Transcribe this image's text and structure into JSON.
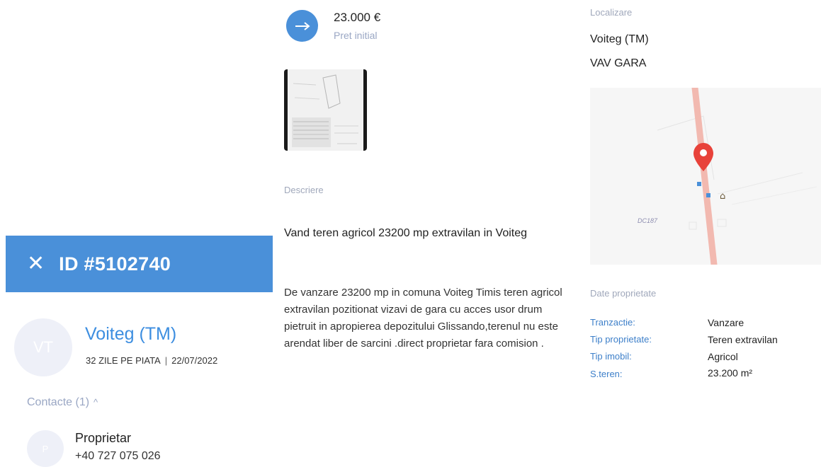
{
  "listing": {
    "id_label": "ID #5102740",
    "close_icon": "close-icon",
    "owner_initials": "VT",
    "city": "Voiteg (TM)",
    "days_on_market": "32 ZILE PE PIATA",
    "meta_separator": "|",
    "date": "22/07/2022",
    "contacts_label": "Contacte (1)",
    "contacts_toggle_icon": "chevron-up-icon",
    "contact": {
      "initial": "P",
      "role": "Proprietar",
      "phone": "+40 727 075 026"
    }
  },
  "price": {
    "icon": "arrow-right-icon",
    "value": "23.000 €",
    "label": "Pret initial"
  },
  "description": {
    "section_label": "Descriere",
    "title": "Vand teren agricol 23200 mp extravilan in Voiteg",
    "body": "De vanzare 23200 mp in comuna Voiteg Timis teren agricol extravilan pozitionat vizavi de gara cu acces usor drum pietruit in apropierea depozitului Glissando,terenul nu este arendat liber de sarcini .direct proprietar fara comision ."
  },
  "location": {
    "section_label": "Localizare",
    "city": "Voiteg (TM)",
    "area": "VAV GARA",
    "map_label": "DC187"
  },
  "property": {
    "section_label": "Date proprietate",
    "rows": [
      {
        "key": "Tranzactie:",
        "value": "Vanzare"
      },
      {
        "key": "Tip proprietate:",
        "value": "Teren extravilan"
      },
      {
        "key": "Tip imobil:",
        "value": "Agricol"
      },
      {
        "key": "S.teren:",
        "value": "23.200 m²"
      }
    ]
  },
  "colors": {
    "accent": "#4a90d9",
    "link": "#3d8ee0",
    "muted": "#9aa7c4",
    "map_road": "#f2b9b0",
    "map_pin": "#e8423a"
  }
}
